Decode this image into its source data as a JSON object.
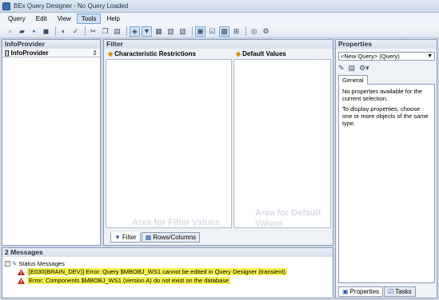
{
  "window": {
    "title": "BEx Query Designer - No Query Loaded"
  },
  "menu": [
    {
      "label": "Query",
      "active": false
    },
    {
      "label": "Edit",
      "active": false
    },
    {
      "label": "View",
      "active": false
    },
    {
      "label": "Tools",
      "active": true
    },
    {
      "label": "Help",
      "active": false
    }
  ],
  "toolbar_icons": [
    "new-icon",
    "open-icon",
    "save-icon",
    "save-all-icon",
    "publish-icon",
    "check-icon",
    "cut-icon",
    "copy-icon",
    "paste-icon",
    "infoprovider-icon",
    "filter-icon",
    "rows-columns-icon",
    "cells-icon",
    "conditions-icon",
    "exceptions-icon",
    "properties-icon",
    "tasks-icon",
    "messages-icon",
    "where-used-icon",
    "tools-dropdown-icon"
  ],
  "infoprovider": {
    "title": "InfoProvider",
    "column_label": "[] InfoProvider"
  },
  "filter": {
    "title": "Filter",
    "char_restrictions_label": "Characteristic Restrictions",
    "default_values_label": "Default Values",
    "filter_area_watermark": "Area for Filter Values",
    "default_area_watermark": "Area for Default Values",
    "tabs": [
      {
        "label": "Filter",
        "selected": true
      },
      {
        "label": "Rows/Columns",
        "selected": false
      }
    ]
  },
  "properties": {
    "title": "Properties",
    "selector_value": "<New Query> (Query)",
    "tab_label": "General",
    "line1": "No properties available for the current selection.",
    "line2": "To display properties, choose one or more objects of the same type.",
    "bottom_tabs": [
      {
        "label": "Properties",
        "selected": true
      },
      {
        "label": "Tasks",
        "selected": false
      }
    ]
  },
  "messages": {
    "title": "2 Messages",
    "root_label": "Status Messages",
    "items": [
      {
        "text": "[E030(BRAIN_DEV)] Error: Query $MBOBJ_WS1 cannot be edited in Query Designer (transient)"
      },
      {
        "text": "Error: Components $MBOBJ_WS1 (version A) do not exist on the database"
      }
    ]
  }
}
